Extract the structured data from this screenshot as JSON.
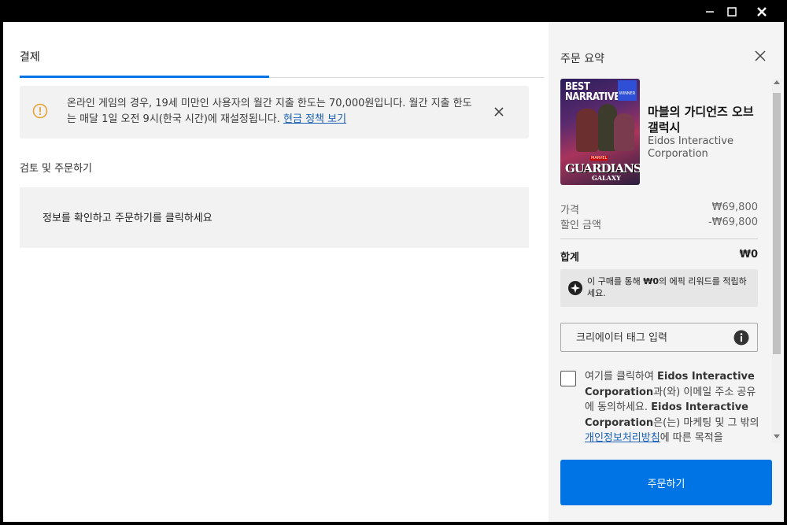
{
  "window": {
    "minimize_glyph": "—",
    "maximize_glyph": "☐",
    "close_glyph": "✕"
  },
  "checkout": {
    "tab_label": "결제",
    "notice": {
      "text": "온라인 게임의 경우, 19세 미만인 사용자의 월간 지출 한도는 70,000원입니다. 월간 지출 한도는 매달 1일 오전 9시(한국 시간)에 재설정됩니다. ",
      "link": "현금 정책 보기"
    },
    "review_title": "검토 및 주문하기",
    "review_text": "정보를 확인하고 주문하기를 클릭하세요"
  },
  "summary": {
    "title": "주문 요약",
    "cover": {
      "badge_line1": "BEST",
      "badge_line2": "NARRATIVE",
      "award_text": "WINNER",
      "brand_small": "MARVEL",
      "logo_main": "GUARDIANS",
      "logo_sub": "GALAXY"
    },
    "game_title": "마블의 가디언즈 오브 갤럭시",
    "publisher": "Eidos Interactive Corporation",
    "price_label": "가격",
    "price_value": "₩69,800",
    "discount_label": "할인 금액",
    "discount_value": "-₩69,800",
    "total_label": "합계",
    "total_value": "₩0",
    "reward": {
      "before": "이 구매를 통해 ",
      "amount": "₩0",
      "after": "의 에픽 리워드를 적립하세요."
    },
    "creator_placeholder": "크리에이터 태그 입력",
    "consent": {
      "t1": "여기를 클릭하여 ",
      "b1": "Eidos Interactive Corporation",
      "t2": "과(와) 이메일 주소 공유에 동의하세요. ",
      "b2": "Eidos Interactive Corporation",
      "t3": "은(는) 마케팅 및 그 밖의 ",
      "link": "개인정보처리방침",
      "t4": "에 따른 목적을"
    },
    "order_button": "주문하기"
  },
  "colors": {
    "accent": "#0074e4",
    "warning": "#e8a33a"
  }
}
